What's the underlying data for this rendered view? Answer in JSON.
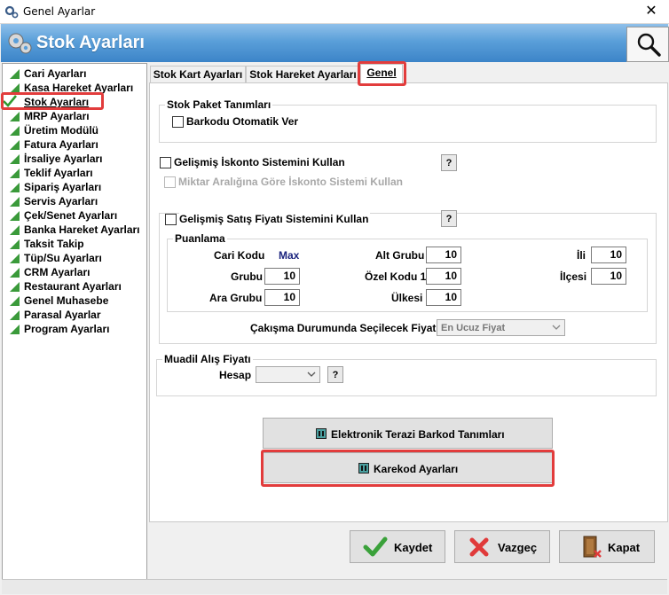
{
  "window": {
    "title": "Genel Ayarlar",
    "close_glyph": "✕"
  },
  "header": {
    "title": "Stok Ayarları"
  },
  "sidebar": {
    "items": [
      {
        "label": "Cari Ayarları"
      },
      {
        "label": "Kasa Hareket Ayarları"
      },
      {
        "label": "Stok Ayarları"
      },
      {
        "label": "MRP Ayarları"
      },
      {
        "label": "Üretim Modülü"
      },
      {
        "label": "Fatura Ayarları"
      },
      {
        "label": "İrsaliye Ayarları"
      },
      {
        "label": "Teklif Ayarları"
      },
      {
        "label": "Sipariş Ayarları"
      },
      {
        "label": "Servis Ayarları"
      },
      {
        "label": "Çek/Senet Ayarları"
      },
      {
        "label": "Banka Hareket Ayarları"
      },
      {
        "label": "Taksit Takip"
      },
      {
        "label": "Tüp/Su Ayarları"
      },
      {
        "label": "CRM Ayarları"
      },
      {
        "label": "Restaurant Ayarları"
      },
      {
        "label": "Genel Muhasebe"
      },
      {
        "label": "Parasal Ayarlar"
      },
      {
        "label": "Program Ayarları"
      }
    ],
    "selected": "Stok Ayarları"
  },
  "tabs": [
    {
      "label": "Stok Kart Ayarları"
    },
    {
      "label": "Stok Hareket Ayarları"
    },
    {
      "label": "Genel"
    }
  ],
  "paket": {
    "legend": "Stok Paket Tanımları",
    "barkod_label": "Barkodu Otomatik Ver"
  },
  "iskonto": {
    "main_label": "Gelişmiş İskonto Sistemini Kullan",
    "sub_label": "Miktar Aralığına Göre İskonto Sistemi Kullan",
    "help": "?"
  },
  "satis": {
    "main_label": "Gelişmiş Satış Fiyatı Sistemini Kullan",
    "help": "?",
    "puanlama_legend": "Puanlama",
    "cari_kodu_label": "Cari Kodu",
    "cari_kodu_value": "Max",
    "grubu_label": "Grubu",
    "grubu_value": "10",
    "ara_grubu_label": "Ara Grubu",
    "ara_grubu_value": "10",
    "alt_grubu_label": "Alt Grubu",
    "alt_grubu_value": "10",
    "ozel_kodu_label": "Özel Kodu 1",
    "ozel_kodu_value": "10",
    "ulkesi_label": "Ülkesi",
    "ulkesi_value": "10",
    "ili_label": "İli",
    "ili_value": "10",
    "ilcesi_label": "İlçesi",
    "ilcesi_value": "10",
    "cakisma_label": "Çakışma Durumunda Seçilecek Fiyat",
    "cakisma_value": "En Ucuz Fiyat"
  },
  "muadil": {
    "legend": "Muadil Alış Fiyatı",
    "hesap_label": "Hesap",
    "hesap_value": "",
    "help": "?"
  },
  "buttons": {
    "terazi": "Elektronik Terazi Barkod Tanımları",
    "karekod": "Karekod Ayarları",
    "kaydet": "Kaydet",
    "vazgec": "Vazgeç",
    "kapat": "Kapat"
  },
  "colors": {
    "accent_red": "#e23c3c",
    "header_blue": "#3c84c8",
    "value_blue": "#1a237e"
  }
}
